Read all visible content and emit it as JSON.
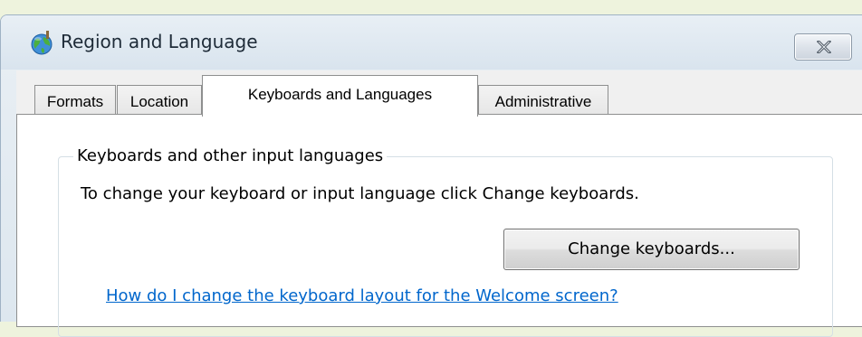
{
  "window": {
    "title": "Region and Language",
    "icon": "globe-icon",
    "close_icon": "close-icon"
  },
  "tabs": [
    {
      "label": "Formats",
      "active": false
    },
    {
      "label": "Location",
      "active": false
    },
    {
      "label": "Keyboards and Languages",
      "active": true
    },
    {
      "label": "Administrative",
      "active": false
    }
  ],
  "keyboards_group": {
    "legend": "Keyboards and other input languages",
    "description": "To change your keyboard or input language click Change keyboards.",
    "change_button_label": "Change keyboards...",
    "help_link": "How do I change the keyboard layout for the Welcome screen?"
  },
  "colors": {
    "link": "#0066cc",
    "background": "#eef3dd"
  }
}
